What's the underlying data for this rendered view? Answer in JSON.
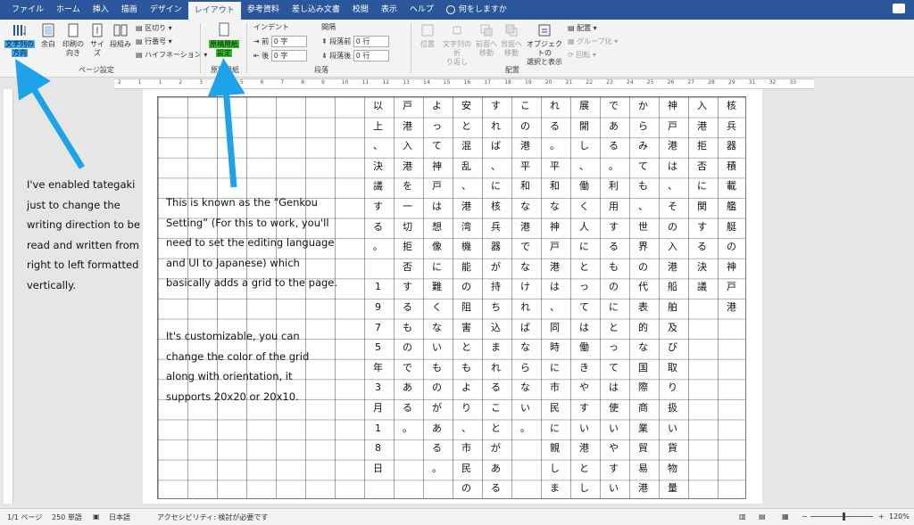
{
  "tabs": [
    "ファイル",
    "ホーム",
    "挿入",
    "描画",
    "デザイン",
    "レイアウト",
    "参考資料",
    "差し込み文書",
    "校閲",
    "表示",
    "ヘルプ"
  ],
  "tell_me": "何をしますか",
  "ribbon": {
    "text_direction": [
      "文字列の",
      "方向"
    ],
    "margins": "余白",
    "orientation": [
      "印刷の",
      "向き"
    ],
    "size": "サイズ",
    "columns": "段組み",
    "breaks": "区切り",
    "line_numbers": "行番号",
    "hyphenation": "ハイフネーション",
    "page_setup_label": "ページ設定",
    "genkou_button": [
      "原稿用紙",
      "設定"
    ],
    "genkou_label": "原稿用紙",
    "indent_label": "インデント",
    "spacing_label": "間隔",
    "indent_before": "前",
    "indent_after": "後",
    "indent_before_value": "0 字",
    "indent_after_value": "0 字",
    "space_before": "段落前",
    "space_after": "段落後",
    "space_before_value": "0 行",
    "space_after_value": "0 行",
    "paragraph_label": "段落",
    "position": "位置",
    "wrap_text": [
      "文字列の折",
      "り返し"
    ],
    "bring_forward": [
      "前面へ",
      "移動"
    ],
    "send_backward": [
      "背面へ",
      "移動"
    ],
    "selection_pane": [
      "オブジェクトの",
      "選択と表示"
    ],
    "align": "配置",
    "group": "グループ化",
    "rotate": "回転",
    "arrange_label": "配置"
  },
  "ruler_numbers": [
    "2",
    "1",
    "1",
    "2",
    "3",
    "4",
    "5",
    "6",
    "7",
    "8",
    "9",
    "10",
    "11",
    "12",
    "13",
    "14",
    "15",
    "16",
    "17",
    "18",
    "19",
    "20",
    "21",
    "22",
    "23",
    "24",
    "25",
    "26",
    "27",
    "28",
    "29",
    "31",
    "32",
    "33"
  ],
  "columns": [
    [
      "核",
      "兵",
      "器",
      "積",
      "載",
      "艦",
      "艇",
      "の",
      "神",
      "戸",
      "港"
    ],
    [
      "入",
      "港",
      "拒",
      "否",
      "に",
      "関",
      "す",
      "る",
      "決",
      "議"
    ],
    [
      "神",
      "戸",
      "港",
      "は",
      "、",
      "そ",
      "の",
      "入",
      "港",
      "船",
      "舶",
      "及",
      "び",
      "取",
      "り",
      "扱",
      "い",
      "貨",
      "物",
      "量"
    ],
    [
      "か",
      "ら",
      "み",
      "て",
      "も",
      "、",
      "世",
      "界",
      "の",
      "代",
      "表",
      "的",
      "な",
      "国",
      "際",
      "商",
      "業",
      "貿",
      "易",
      "港"
    ],
    [
      "で",
      "あ",
      "る",
      "。",
      "利",
      "用",
      "す",
      "る",
      "も",
      "の",
      "に",
      "と",
      "っ",
      "て",
      "は",
      "使",
      "い",
      "や",
      "す",
      "い"
    ],
    [
      "展",
      "開",
      "し",
      "、",
      "働",
      "く",
      "人",
      "に",
      "と",
      "っ",
      "て",
      "は",
      "働",
      "き",
      "や",
      "す",
      "い",
      "港",
      "と",
      "し"
    ],
    [
      "れ",
      "る",
      "。",
      "平",
      "和",
      "な",
      "神",
      "戸",
      "港",
      "は",
      "、",
      "同",
      "時",
      "に",
      "市",
      "民",
      "に",
      "親",
      "し",
      "ま"
    ],
    [
      "こ",
      "の",
      "港",
      "平",
      "和",
      "な",
      "港",
      "で",
      "な",
      "け",
      "れ",
      "ば",
      "な",
      "ら",
      "な",
      "い",
      "。"
    ],
    [
      "す",
      "れ",
      "ば",
      "、",
      "に",
      "核",
      "兵",
      "器",
      "が",
      "持",
      "ち",
      "込",
      "ま",
      "れ",
      "る",
      "こ",
      "と",
      "が",
      "あ",
      "る"
    ],
    [
      "安",
      "と",
      "混",
      "乱",
      "、",
      "港",
      "湾",
      "機",
      "能",
      "の",
      "阻",
      "害",
      "と",
      "も",
      "よ",
      "り",
      "、",
      "市",
      "民",
      "の"
    ],
    [
      "よ",
      "っ",
      "て",
      "神",
      "戸",
      "は",
      "想",
      "像",
      "に",
      "難",
      "く",
      "な",
      "い",
      "も",
      "の",
      "が",
      "あ",
      "る",
      "。"
    ],
    [
      "戸",
      "港",
      "入",
      "港",
      "を",
      "一",
      "切",
      "拒",
      "否",
      "す",
      "る",
      "も",
      "の",
      "で",
      "あ",
      "る",
      "。"
    ],
    [
      "以",
      "上",
      "、",
      "決",
      "議",
      "す",
      "る",
      "。",
      "",
      "1",
      "9",
      "7",
      "5",
      "年",
      "3",
      "月",
      "1",
      "8",
      "日"
    ]
  ],
  "annotation_left": "I've enabled tategaki just to change the writing direction to be read and written from right to left formatted vertically.",
  "annotation_mid_1": "This is known as the “Genkou Setting” (For this to work, you'll need to set the editing language and UI to Japanese) which basically adds a grid to the page.",
  "annotation_mid_2": "It's customizable, you can change the color of the grid along with orientation, it supports 20x20 or 20x10.",
  "status": {
    "page": "1/1 ページ",
    "words": "250 単語",
    "language": "日本語",
    "accessibility": "アクセシビリティ: 検討が必要です",
    "zoom": "120%"
  },
  "colors": {
    "title_bar": "#2b579a",
    "highlight_blue": "#3da9f5",
    "highlight_green": "#35c52b",
    "arrow": "#1fa3e8"
  }
}
